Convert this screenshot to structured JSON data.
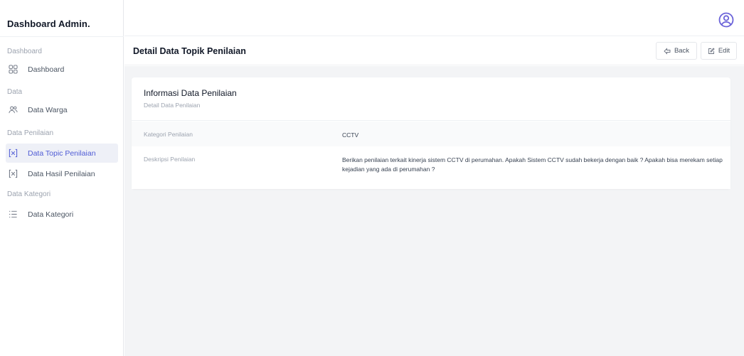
{
  "sidebar": {
    "brand": "Dashboard Admin.",
    "sections": [
      {
        "title": "Dashboard",
        "items": [
          {
            "label": "Dashboard",
            "icon": "grid-icon",
            "active": false
          }
        ]
      },
      {
        "title": "Data",
        "items": [
          {
            "label": "Data Warga",
            "icon": "users-icon",
            "active": false
          }
        ]
      },
      {
        "title": "Data Penilaian",
        "items": [
          {
            "label": "Data Topic Penilaian",
            "icon": "bracket-x-icon",
            "active": true
          },
          {
            "label": "Data Hasil Penilaian",
            "icon": "bracket-x-icon",
            "active": false
          }
        ]
      },
      {
        "title": "Data Kategori",
        "items": [
          {
            "label": "Data Kategori",
            "icon": "list-icon",
            "active": false
          }
        ]
      }
    ]
  },
  "header": {
    "title": "Detail Data Topik Penilaian",
    "back_label": "Back",
    "edit_label": "Edit"
  },
  "card": {
    "title": "Informasi Data Penilaian",
    "subtitle": "Detail Data Penilaian",
    "rows": [
      {
        "label": "Kategori Penilaian",
        "value": "CCTV"
      },
      {
        "label": "Deskripsi Penilaian",
        "value": "Berikan penilaian terkait kinerja sistem CCTV di perumahan. Apakah Sistem CCTV sudah bekerja dengan baik ? Apakah bisa merekam setiap kejadian yang ada di perumahan ?"
      }
    ]
  },
  "colors": {
    "accent": "#4f5bd5",
    "active_bg": "#eef0f7",
    "content_bg": "#f3f4f6",
    "avatar": "#6b63d9"
  }
}
